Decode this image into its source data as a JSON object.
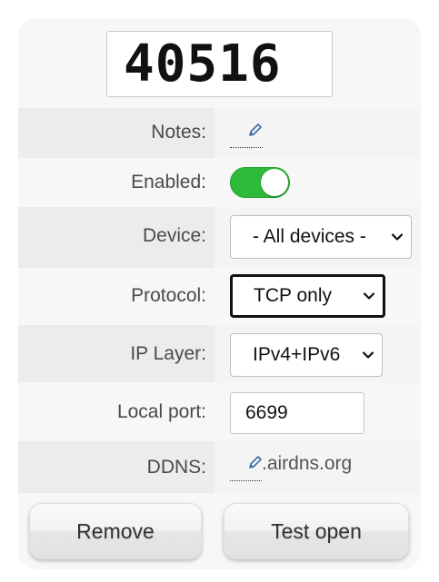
{
  "port_number": "40516",
  "fields": {
    "notes": {
      "label": "Notes:"
    },
    "enabled": {
      "label": "Enabled:",
      "value": true
    },
    "device": {
      "label": "Device:",
      "selected": "- All devices -"
    },
    "protocol": {
      "label": "Protocol:",
      "selected": "TCP only"
    },
    "ip_layer": {
      "label": "IP Layer:",
      "selected": "IPv4+IPv6"
    },
    "local_port": {
      "label": "Local port:",
      "value": "6699"
    },
    "ddns": {
      "label": "DDNS:",
      "value": ".airdns.org"
    }
  },
  "buttons": {
    "remove": "Remove",
    "test_open": "Test open"
  },
  "colors": {
    "toggle_on": "#2fba3a",
    "pencil": "#3a6ea8"
  },
  "icons": {
    "edit": "pencil-icon",
    "dropdown": "chevron-down-icon"
  }
}
